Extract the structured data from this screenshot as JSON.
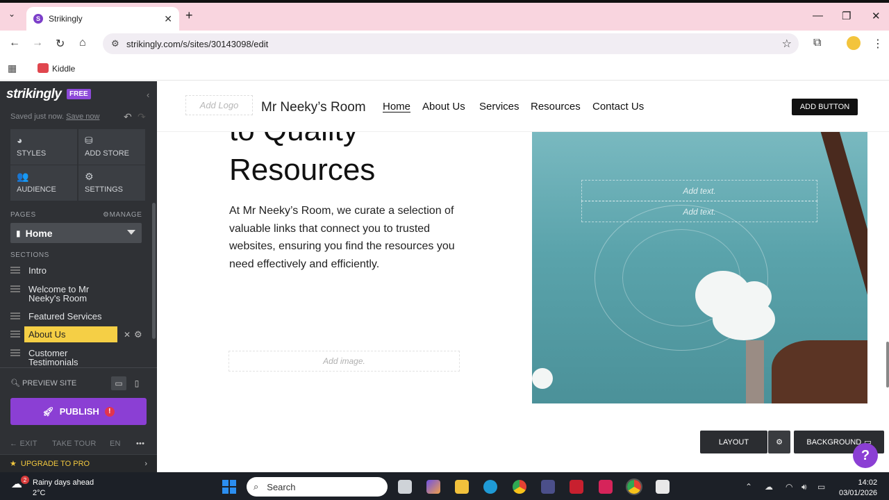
{
  "browser": {
    "tab_title": "Strikingly",
    "tab_favicon_letter": "S",
    "url": "strikingly.com/s/sites/30143098/edit",
    "bookmark_label": "Kiddle"
  },
  "sidebar": {
    "brand": "strikingly",
    "plan_badge": "FREE",
    "saved_text": "Saved just now.",
    "save_now_link": "Save now",
    "tiles": [
      {
        "label": "STYLES",
        "icon": "palette-icon"
      },
      {
        "label": "ADD STORE",
        "icon": "store-icon"
      },
      {
        "label": "AUDIENCE",
        "icon": "people-icon"
      },
      {
        "label": "SETTINGS",
        "icon": "gear-icon"
      }
    ],
    "pages_header": "PAGES",
    "manage_label": "MANAGE",
    "current_page": "Home",
    "sections_header": "SECTIONS",
    "sections": [
      {
        "label": "Intro"
      },
      {
        "label": "Welcome to Mr Neeky's Room"
      },
      {
        "label": "Featured Services"
      },
      {
        "label": "About Us"
      },
      {
        "label": "Customer Testimonials"
      }
    ],
    "preview_label": "PREVIEW SITE",
    "publish_label": "PUBLISH",
    "publish_alert": "!",
    "footer": {
      "exit": "EXIT",
      "tour": "TAKE TOUR",
      "lang": "EN",
      "more": "•••"
    },
    "upgrade_label": "UPGRADE TO PRO"
  },
  "site_header": {
    "add_logo": "Add Logo",
    "title": "Mr Neeky’s Room",
    "nav": [
      "Home",
      "About Us",
      "Services",
      "Resources",
      "Contact Us"
    ],
    "add_button": "ADD BUTTON"
  },
  "content": {
    "heading_line1": "to Quality",
    "heading_line2": "Resources",
    "paragraph": "At Mr Neeky’s Room, we curate a selection of valuable links that connect you to trusted websites, ensuring you find the resources you need effectively and efficiently.",
    "add_image": "Add image.",
    "add_text_1": "Add text.",
    "add_text_2": "Add text.",
    "layout_label": "LAYOUT",
    "background_label": "BACKGROUND",
    "help_label": "?"
  },
  "taskbar": {
    "weather_badge": "2",
    "weather_line1": "Rainy days ahead",
    "weather_line2": "2°C",
    "search_placeholder": "Search",
    "time": "14:02",
    "date": "03/01/2026"
  },
  "colors": {
    "accent_purple": "#8b3fd4",
    "active_section": "#f5cf45",
    "sidebar_bg": "#2f3135",
    "tabbar_bg": "#f9d5df"
  }
}
